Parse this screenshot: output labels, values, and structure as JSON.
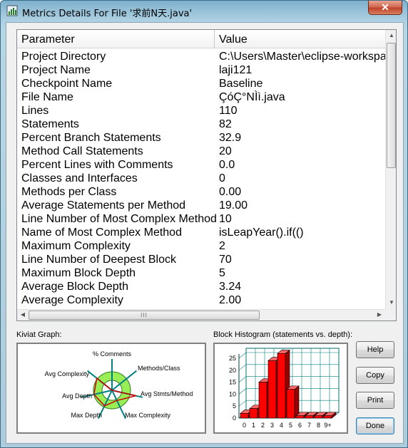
{
  "window": {
    "title": "Metrics Details For File '求前N天.java'",
    "close_symbol": "✕"
  },
  "table": {
    "headers": [
      "Parameter",
      "Value"
    ],
    "rows": [
      [
        "Project Directory",
        "C:\\Users\\Master\\eclipse-workspace"
      ],
      [
        "Project Name",
        "laji121"
      ],
      [
        "Checkpoint Name",
        "Baseline"
      ],
      [
        "File Name",
        "ÇóÇ°NÌì.java"
      ],
      [
        "Lines",
        "110"
      ],
      [
        "Statements",
        "82"
      ],
      [
        "Percent Branch Statements",
        "32.9"
      ],
      [
        "Method Call Statements",
        "20"
      ],
      [
        "Percent Lines with Comments",
        "0.0"
      ],
      [
        "Classes and Interfaces",
        "0"
      ],
      [
        "Methods per Class",
        "0.00"
      ],
      [
        "Average Statements per Method",
        "19.00"
      ],
      [
        "Line Number of Most Complex Method",
        "10"
      ],
      [
        "Name of Most Complex Method",
        "isLeapYear().if(()"
      ],
      [
        "Maximum Complexity",
        "2"
      ],
      [
        "Line Number of Deepest Block",
        "70"
      ],
      [
        "Maximum Block Depth",
        "5"
      ],
      [
        "Average Block Depth",
        "3.24"
      ],
      [
        "Average Complexity",
        "2.00"
      ]
    ]
  },
  "hscroll_grip": "III",
  "kiviat": {
    "label": "Kiviat Graph:",
    "axes": [
      "% Comments",
      "Methods/Class",
      "Avg Stmts/Method",
      "Max Complexity",
      "Max Depth",
      "Avg Depth",
      "Avg Complexity"
    ],
    "values": [
      0.0,
      0.0,
      0.78,
      0.36,
      0.55,
      0.59,
      0.62
    ],
    "colors": {
      "band": "#99ee55",
      "plot": "#cc0000",
      "spoke": "#008080"
    }
  },
  "histogram": {
    "label": "Block Histogram (statements vs. depth):",
    "chart_data": {
      "type": "bar",
      "categories": [
        "0",
        "1",
        "2",
        "3",
        "4",
        "5",
        "6",
        "7",
        "8",
        "9+"
      ],
      "values": [
        2,
        4,
        15,
        24,
        27,
        12,
        1,
        1,
        1,
        1
      ],
      "y_ticks": [
        "0",
        "5",
        "10",
        "15",
        "20",
        "25"
      ],
      "ylim": [
        0,
        25
      ],
      "bar_color": "#ff0000"
    }
  },
  "buttons": {
    "help": "Help",
    "copy": "Copy",
    "print": "Print",
    "done": "Done"
  }
}
